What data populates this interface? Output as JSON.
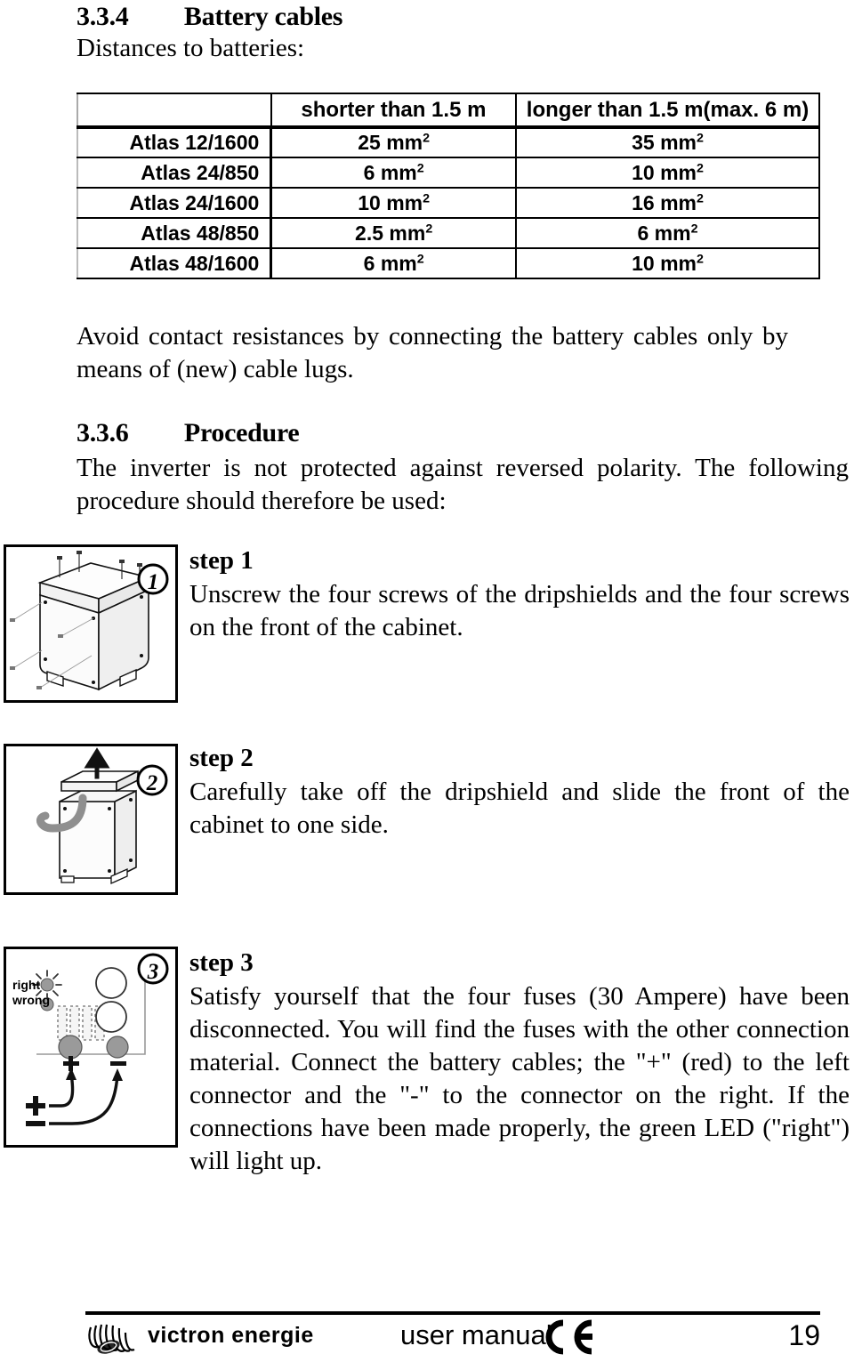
{
  "section_battery_cables": {
    "number": "3.3.4",
    "title": "Battery cables",
    "intro": "Distances to batteries:"
  },
  "cable_table": {
    "headers": [
      "",
      "shorter than 1.5 m",
      "longer than 1.5 m(max. 6 m)"
    ],
    "unit_exponent": "2",
    "rows": [
      {
        "model": "Atlas 12/1600",
        "short": "25 mm",
        "long": "35 mm"
      },
      {
        "model": "Atlas 24/850",
        "short": "6 mm",
        "long": "10 mm"
      },
      {
        "model": "Atlas 24/1600",
        "short": "10 mm",
        "long": "16 mm"
      },
      {
        "model": "Atlas 48/850",
        "short": "2.5 mm",
        "long": "6 mm"
      },
      {
        "model": "Atlas 48/1600",
        "short": "6 mm",
        "long": "10 mm"
      }
    ]
  },
  "note_contact_resistance": "Avoid contact resistances by connecting the battery cables only by means of (new) cable lugs.",
  "section_procedure": {
    "number": "3.3.6",
    "title": "Procedure",
    "intro": "The inverter is not protected against reversed polarity. The following procedure should therefore be used:"
  },
  "steps": [
    {
      "badge": "1",
      "label": "step 1",
      "text": "Unscrew the four screws of the dripshields and the four screws on the front of the cabinet."
    },
    {
      "badge": "2",
      "label": "step 2",
      "text": "Carefully take off the dripshield and slide the front of the cabinet to one side."
    },
    {
      "badge": "3",
      "label": "step 3",
      "text": "Satisfy yourself that the four fuses (30 Ampere) have been disconnected. You will find the fuses with the other connection material. Connect the battery cables; the \"+\" (red) to the left connector and the \"-\" to the connector on the right. If the connections have been made properly, the green LED (\"right\") will light up."
    }
  ],
  "step3_diagram": {
    "led_right_label": "right",
    "led_wrong_label": "wrong",
    "terminal_positive": "+",
    "terminal_negative": "–",
    "battery_positive": "+",
    "battery_negative": "–"
  },
  "footer": {
    "brand": "victron  energie",
    "document_type": "user manual",
    "ce_mark": "CE",
    "page_number": "19"
  },
  "colors": {
    "ink": "#000000",
    "paper": "#ffffff",
    "fig_gray": "#9a9a9a",
    "fig_light": "#d8d8d8"
  }
}
